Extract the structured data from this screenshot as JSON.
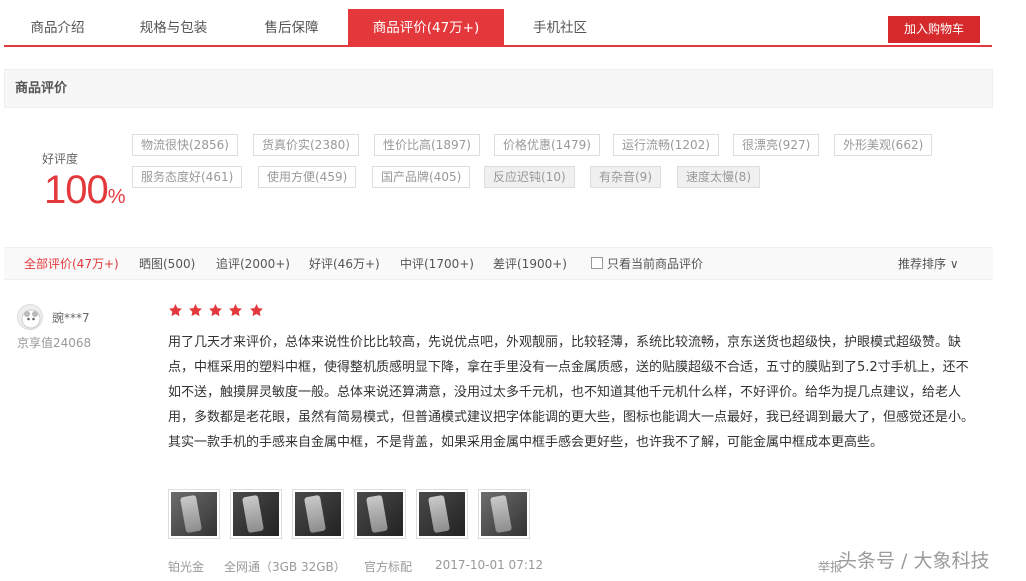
{
  "tabs": [
    {
      "label": "商品介绍"
    },
    {
      "label": "规格与包装"
    },
    {
      "label": "售后保障"
    },
    {
      "label": "商品评价(47万+)"
    },
    {
      "label": "手机社区"
    }
  ],
  "cart_button": "加入购物车",
  "section_title": "商品评价",
  "rating": {
    "label": "好评度",
    "value": "100",
    "unit": "%"
  },
  "tags": [
    "物流很快(2856)",
    "货真价实(2380)",
    "性价比高(1897)",
    "价格优惠(1479)",
    "运行流畅(1202)",
    "很漂亮(927)",
    "外形美观(662)",
    "服务态度好(461)",
    "使用方便(459)",
    "国产品牌(405)",
    "反应迟钝(10)",
    "有杂音(9)",
    "速度太慢(8)"
  ],
  "filters": [
    "全部评价(47万+)",
    "晒图(500)",
    "追评(2000+)",
    "好评(46万+)",
    "中评(1700+)",
    "差评(1900+)"
  ],
  "only_current": "只看当前商品评价",
  "sort": "推荐排序",
  "review": {
    "username": "豌***7",
    "level": "京享值24068",
    "stars": 5,
    "text": "用了几天才来评价，总体来说性价比比较高，先说优点吧，外观靓丽，比较轻薄，系统比较流畅，京东送货也超级快，护眼模式超级赞。缺点，中框采用的塑料中框，使得整机质感明显下降，拿在手里没有一点金属质感，送的贴膜超级不合适，五寸的膜贴到了5.2寸手机上，还不如不送，触摸屏灵敏度一般。总体来说还算满意，没用过太多千元机，也不知道其他千元机什么样，不好评价。给华为提几点建议，给老人用，多数都是老花眼，虽然有简易模式，但普通模式建议把字体能调的更大些，图标也能调大一点最好，我已经调到最大了，但感觉还是小。其实一款手机的手感来自金属中框，不是背盖，如果采用金属中框手感会更好些，也许我不了解，可能金属中框成本更高些。",
    "meta": [
      "铂光金",
      "全网通（3GB 32GB）",
      "官方标配",
      "2017-10-01 07:12"
    ],
    "report": "举报"
  },
  "watermark": "头条号 / 大象科技",
  "colors": {
    "accent": "#e4393c"
  }
}
